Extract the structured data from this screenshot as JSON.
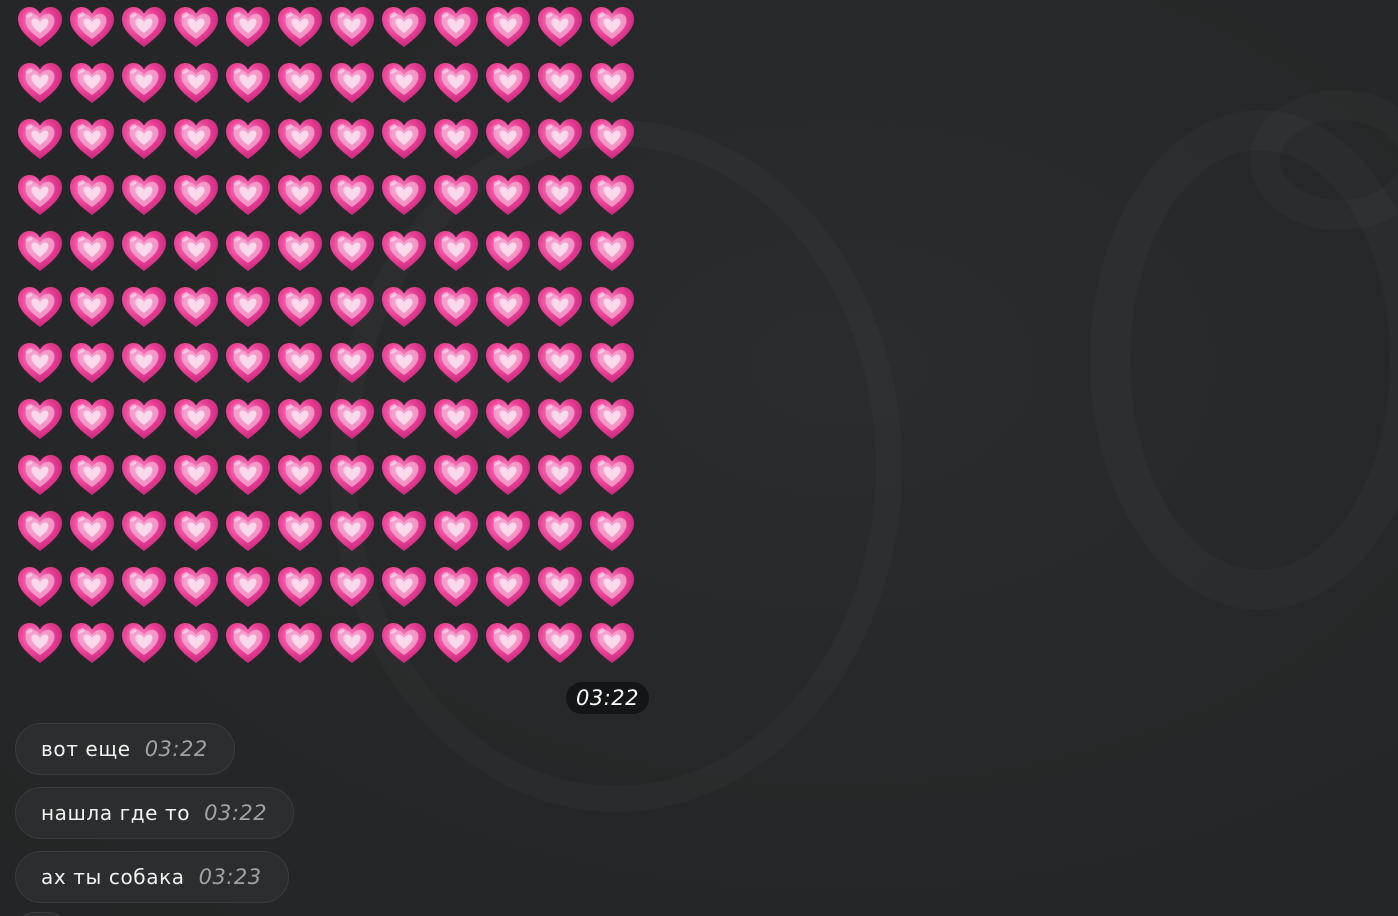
{
  "emoji_message": {
    "emoji": "💗",
    "emoji_name": "growing-heart",
    "rows": 12,
    "columns": 12,
    "time": "03:22"
  },
  "messages": [
    {
      "text": "вот еще",
      "time": "03:22"
    },
    {
      "text": "нашла где то",
      "time": "03:22"
    },
    {
      "text": "ах ты собака",
      "time": "03:23"
    }
  ],
  "colors": {
    "background": "#262829",
    "bubble": "#2b2d2e",
    "heart_pink": "#e8479a",
    "time_badge": "#141516"
  }
}
